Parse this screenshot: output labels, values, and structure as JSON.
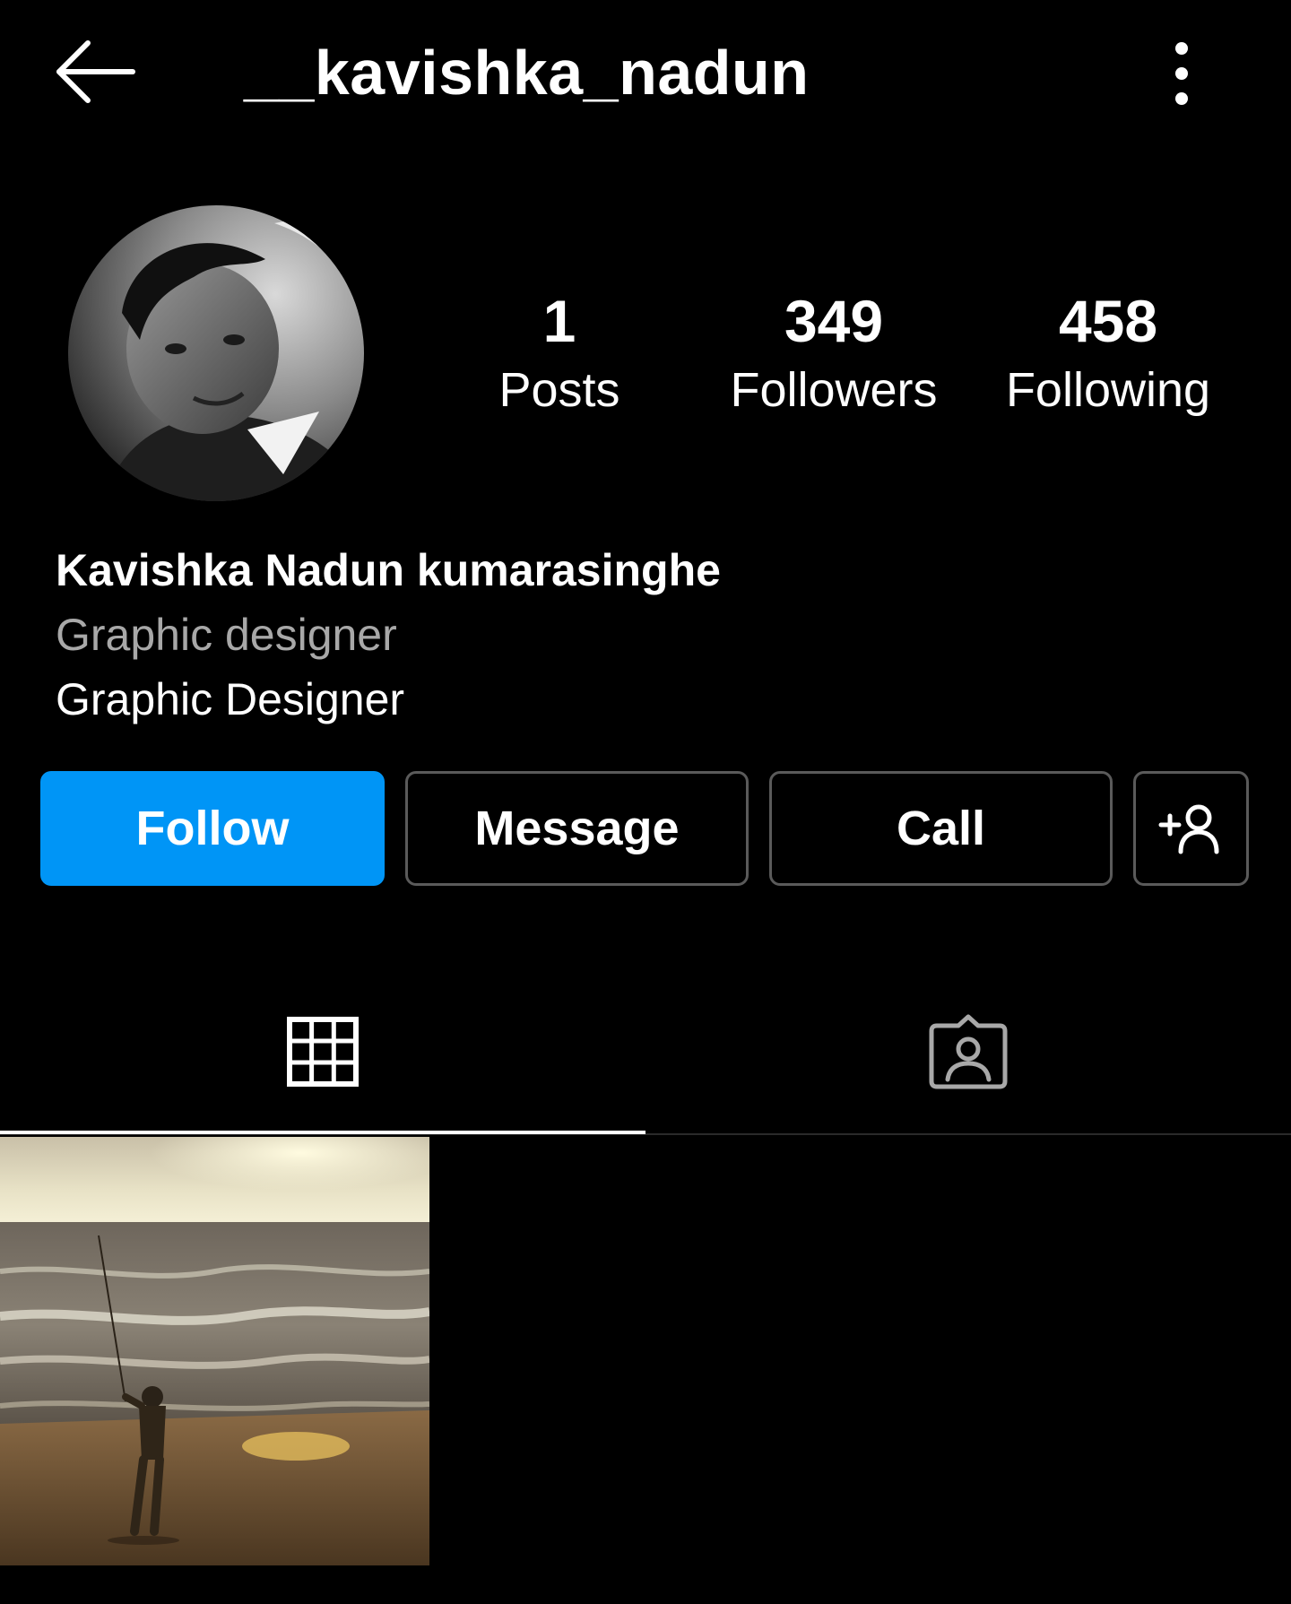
{
  "header": {
    "username": "__kavishka_nadun",
    "back_icon": "arrow-left-icon",
    "more_icon": "more-vertical-icon"
  },
  "profile": {
    "stats": {
      "posts": {
        "value": "1",
        "label": "Posts"
      },
      "followers": {
        "value": "349",
        "label": "Followers"
      },
      "following": {
        "value": "458",
        "label": "Following"
      }
    },
    "full_name": "Kavishka Nadun kumarasinghe",
    "category": "Graphic designer",
    "bio": "Graphic Designer"
  },
  "actions": {
    "follow_label": "Follow",
    "message_label": "Message",
    "call_label": "Call",
    "add_user_icon": "add-user-icon"
  },
  "tabs": {
    "grid_icon": "grid-icon",
    "tagged_icon": "tagged-icon",
    "active": "grid"
  },
  "colors": {
    "background": "#000000",
    "accent": "#0095f6",
    "secondary_text": "#a8a8a8",
    "outline": "#5a5a5a"
  }
}
